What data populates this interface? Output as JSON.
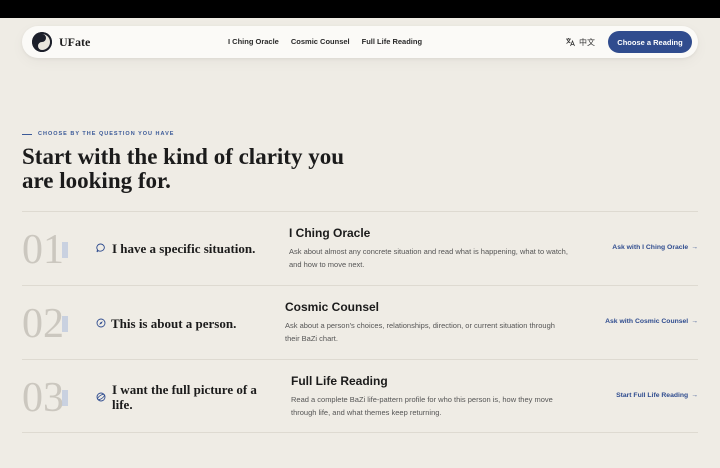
{
  "nav": {
    "brand": "UFate",
    "links": [
      "I Ching Oracle",
      "Cosmic Counsel",
      "Full Life Reading"
    ],
    "lang_label": "中文",
    "cta_label": "Choose a Reading"
  },
  "hero": {
    "eyebrow": "CHOOSE BY THE QUESTION YOU HAVE",
    "title_line1": "Start with the kind of clarity you",
    "title_line2": "are looking for."
  },
  "rows": [
    {
      "number": "01",
      "icon": "chat-bubble-icon",
      "question": "I have a specific situation.",
      "name": "I Ching Oracle",
      "desc": "Ask about almost any concrete situation and read what is happening, what to watch, and how to move next.",
      "link": "Ask with I Ching Oracle"
    },
    {
      "number": "02",
      "icon": "compass-icon",
      "question": "This is about a person.",
      "name": "Cosmic Counsel",
      "desc": "Ask about a person's choices, relationships, direction, or current situation through their BaZi chart.",
      "link": "Ask with Cosmic Counsel"
    },
    {
      "number": "03",
      "icon": "orbit-icon",
      "question": "I want the full picture of a life.",
      "name": "Full Life Reading",
      "desc": "Read a complete BaZi life-pattern profile for who this person is, how they move through life, and what themes keep returning.",
      "link": "Start Full Life Reading"
    }
  ],
  "colors": {
    "background": "#efece5",
    "accent": "#304c8e",
    "link": "#2f4c8f"
  }
}
